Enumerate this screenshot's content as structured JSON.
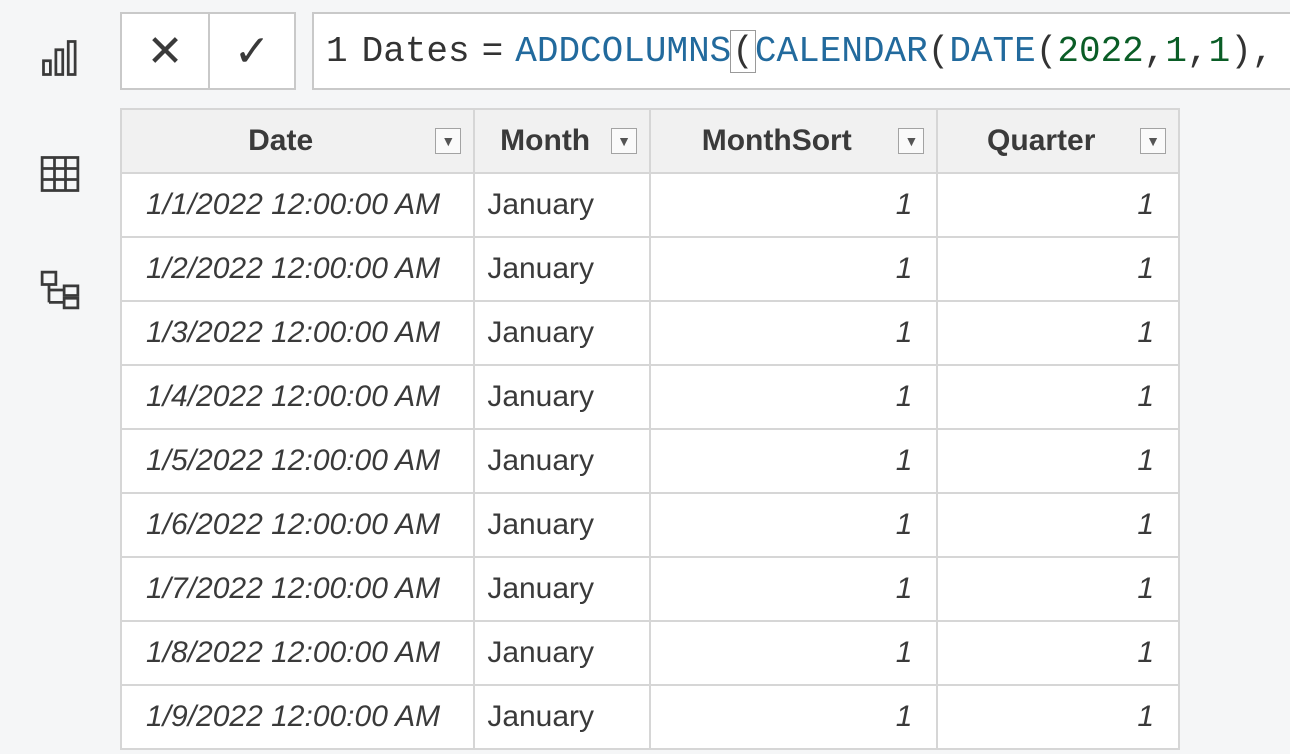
{
  "formula": {
    "line_number": "1",
    "identifier": "Dates",
    "equals": "=",
    "fn_addcolumns": "ADDCOLUMNS",
    "fn_calendar": "CALENDAR",
    "fn_date": "DATE",
    "arg_year": "2022",
    "arg_month": "1",
    "arg_day": "1",
    "trailing_comma": ","
  },
  "columns": [
    {
      "label": "Date"
    },
    {
      "label": "Month"
    },
    {
      "label": "MonthSort"
    },
    {
      "label": "Quarter"
    }
  ],
  "rows": [
    {
      "date": "1/1/2022 12:00:00 AM",
      "month": "January",
      "monthsort": "1",
      "quarter": "1"
    },
    {
      "date": "1/2/2022 12:00:00 AM",
      "month": "January",
      "monthsort": "1",
      "quarter": "1"
    },
    {
      "date": "1/3/2022 12:00:00 AM",
      "month": "January",
      "monthsort": "1",
      "quarter": "1"
    },
    {
      "date": "1/4/2022 12:00:00 AM",
      "month": "January",
      "monthsort": "1",
      "quarter": "1"
    },
    {
      "date": "1/5/2022 12:00:00 AM",
      "month": "January",
      "monthsort": "1",
      "quarter": "1"
    },
    {
      "date": "1/6/2022 12:00:00 AM",
      "month": "January",
      "monthsort": "1",
      "quarter": "1"
    },
    {
      "date": "1/7/2022 12:00:00 AM",
      "month": "January",
      "monthsort": "1",
      "quarter": "1"
    },
    {
      "date": "1/8/2022 12:00:00 AM",
      "month": "January",
      "monthsort": "1",
      "quarter": "1"
    },
    {
      "date": "1/9/2022 12:00:00 AM",
      "month": "January",
      "monthsort": "1",
      "quarter": "1"
    }
  ]
}
